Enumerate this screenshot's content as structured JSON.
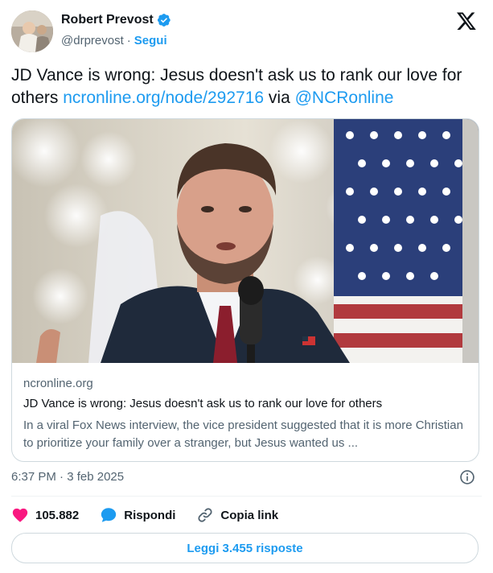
{
  "author": {
    "name": "Robert Prevost",
    "handle": "@drprevost",
    "separator": "·",
    "follow_label": "Segui"
  },
  "tweet": {
    "text_prefix": "JD Vance is wrong: Jesus doesn't ask us to rank our love for others ",
    "link_text": "ncronline.org/node/292716",
    "via_text": " via ",
    "mention": "@NCRonline"
  },
  "card": {
    "domain": "ncronline.org",
    "title": "JD Vance is wrong: Jesus doesn't ask us to rank our love for others",
    "description": "In a viral Fox News interview, the vice president suggested that it is more Christian to prioritize your family over a stranger, but Jesus wanted us ..."
  },
  "meta": {
    "timestamp": "6:37 PM · 3 feb 2025"
  },
  "actions": {
    "likes": "105.882",
    "reply_label": "Rispondi",
    "copy_link_label": "Copia link"
  },
  "read_replies_label": "Leggi 3.455 risposte",
  "icons": {
    "verified": "verified-badge-icon",
    "brand": "x-logo-icon",
    "info": "info-icon",
    "like": "heart-icon",
    "reply": "speech-bubble-icon",
    "copy_link": "link-icon"
  },
  "colors": {
    "accent": "#1d9bf0",
    "like": "#f91880",
    "secondary_text": "#536471",
    "border": "#cfd9de"
  }
}
